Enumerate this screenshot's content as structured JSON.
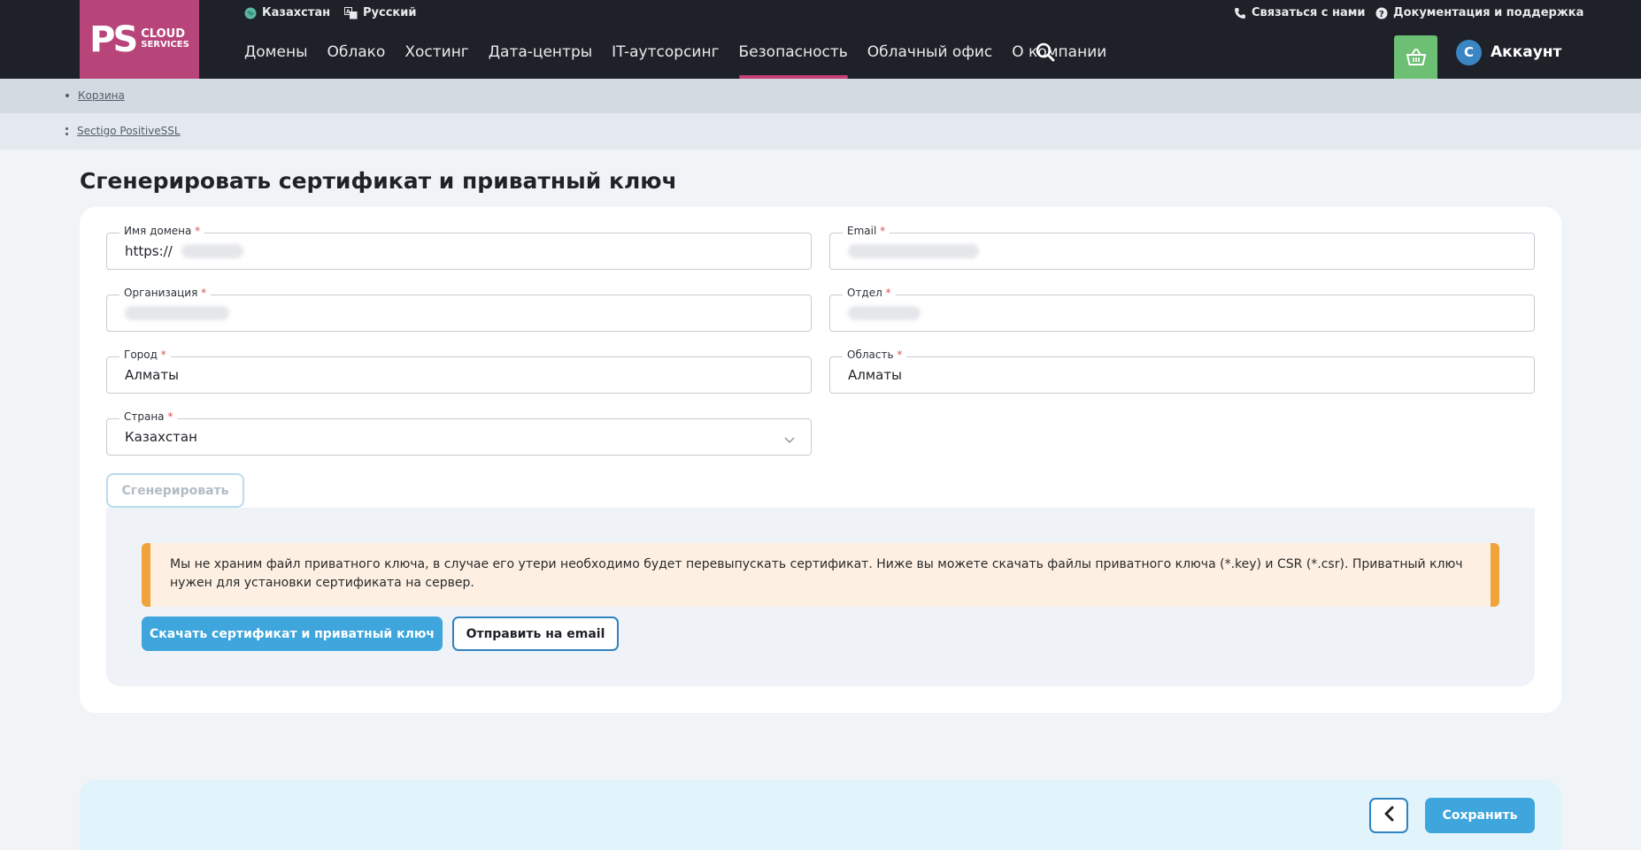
{
  "topbar": {
    "region_label": "Казахстан",
    "language_label": "Русский",
    "contact_label": "Связаться с нами",
    "docs_label": "Документация и поддержка"
  },
  "logo": {
    "mark": "PS",
    "line1": "CLOUD",
    "line2": "SERVICES"
  },
  "nav": {
    "items": [
      {
        "label": "Домены"
      },
      {
        "label": "Облако"
      },
      {
        "label": "Хостинг"
      },
      {
        "label": "Дата-центры"
      },
      {
        "label": "IT-аутсорсинг"
      },
      {
        "label": "Безопасность"
      },
      {
        "label": "Облачный офис"
      },
      {
        "label": "О компании"
      }
    ],
    "active": "Безопасность"
  },
  "account": {
    "initial": "С",
    "label": "Аккаунт"
  },
  "breadcrumbs": {
    "cart": "Корзина",
    "product": "Sectigo PositiveSSL"
  },
  "page": {
    "title": "Сгенерировать сертификат и приватный ключ"
  },
  "form": {
    "domain": {
      "label": "Имя домена",
      "prefix": "https://"
    },
    "email": {
      "label": "Email"
    },
    "organization": {
      "label": "Организация"
    },
    "department": {
      "label": "Отдел"
    },
    "city": {
      "label": "Город",
      "value": "Алматы"
    },
    "region": {
      "label": "Область",
      "value": "Алматы"
    },
    "country": {
      "label": "Страна",
      "value": "Казахстан"
    },
    "required_mark": "*",
    "generate_label": "Сгенерировать"
  },
  "notice": {
    "text": "Мы не храним файл приватного ключа, в случае его утери необходимо будет перевыпускать сертификат. Ниже вы можете скачать файлы приватного ключа (*.key) и CSR (*.csr). Приватный ключ нужен для установки сертификата на сервер."
  },
  "actions": {
    "download_label": "Скачать сертификат и приватный ключ",
    "send_email_label": "Отправить на email",
    "save_label": "Сохранить"
  },
  "colors": {
    "brand": "#b8457a",
    "accent": "#3ea6dc",
    "cart": "#6cbf73",
    "warning": "#f0a33a",
    "active_underline": "#c4417a"
  }
}
